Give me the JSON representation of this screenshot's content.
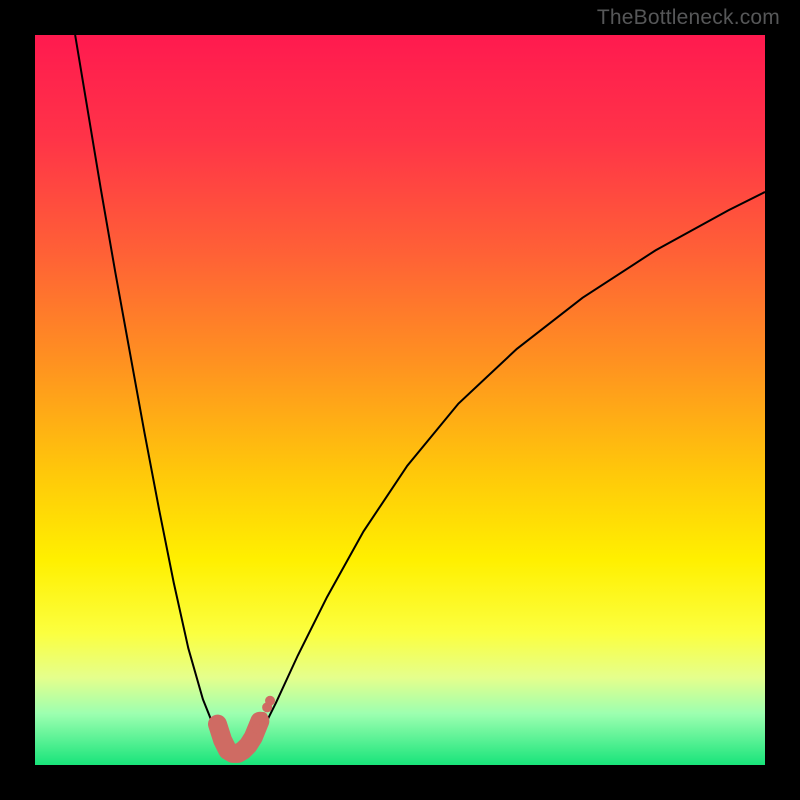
{
  "watermark": "TheBottleneck.com",
  "chart_data": {
    "type": "line",
    "title": "",
    "xlabel": "",
    "ylabel": "",
    "xlim": [
      0,
      100
    ],
    "ylim": [
      0,
      100
    ],
    "grid": false,
    "legend": false,
    "gradient_stops": [
      {
        "pct": 0,
        "color": "#ff1a4f"
      },
      {
        "pct": 14,
        "color": "#ff3348"
      },
      {
        "pct": 30,
        "color": "#ff6136"
      },
      {
        "pct": 45,
        "color": "#ff9220"
      },
      {
        "pct": 60,
        "color": "#ffc80a"
      },
      {
        "pct": 72,
        "color": "#fff000"
      },
      {
        "pct": 82,
        "color": "#fbff40"
      },
      {
        "pct": 88,
        "color": "#e5ff8c"
      },
      {
        "pct": 93,
        "color": "#9cffb0"
      },
      {
        "pct": 100,
        "color": "#18e47a"
      }
    ],
    "series": [
      {
        "name": "curve-left",
        "type": "line",
        "color": "#000000",
        "width": 2,
        "x": [
          5.5,
          7,
          9,
          11,
          13,
          15,
          17,
          19,
          21,
          23,
          25,
          26.4
        ],
        "y": [
          100,
          91,
          79,
          67.5,
          56.5,
          45.5,
          35,
          25,
          16,
          9,
          4,
          2.8
        ]
      },
      {
        "name": "curve-right",
        "type": "line",
        "color": "#000000",
        "width": 2,
        "x": [
          29.6,
          31,
          33,
          36,
          40,
          45,
          51,
          58,
          66,
          75,
          85,
          95,
          100
        ],
        "y": [
          2.8,
          4.5,
          8.5,
          15,
          23,
          32,
          41,
          49.5,
          57,
          64,
          70.5,
          76,
          78.5
        ]
      },
      {
        "name": "u-overlay",
        "type": "line",
        "color": "#cf6b63",
        "width": 19,
        "linecap": "round",
        "x": [
          25.0,
          25.7,
          26.4,
          27.1,
          27.8,
          28.5,
          29.2,
          29.9,
          30.8
        ],
        "y": [
          5.6,
          3.4,
          2.0,
          1.6,
          1.6,
          2.0,
          2.7,
          3.8,
          6.0
        ]
      },
      {
        "name": "u-dots",
        "type": "scatter",
        "color": "#cf6b63",
        "size": 5,
        "x": [
          30.4,
          31.2,
          31.8,
          32.2
        ],
        "y": [
          5.0,
          6.6,
          7.9,
          8.8
        ]
      }
    ]
  }
}
